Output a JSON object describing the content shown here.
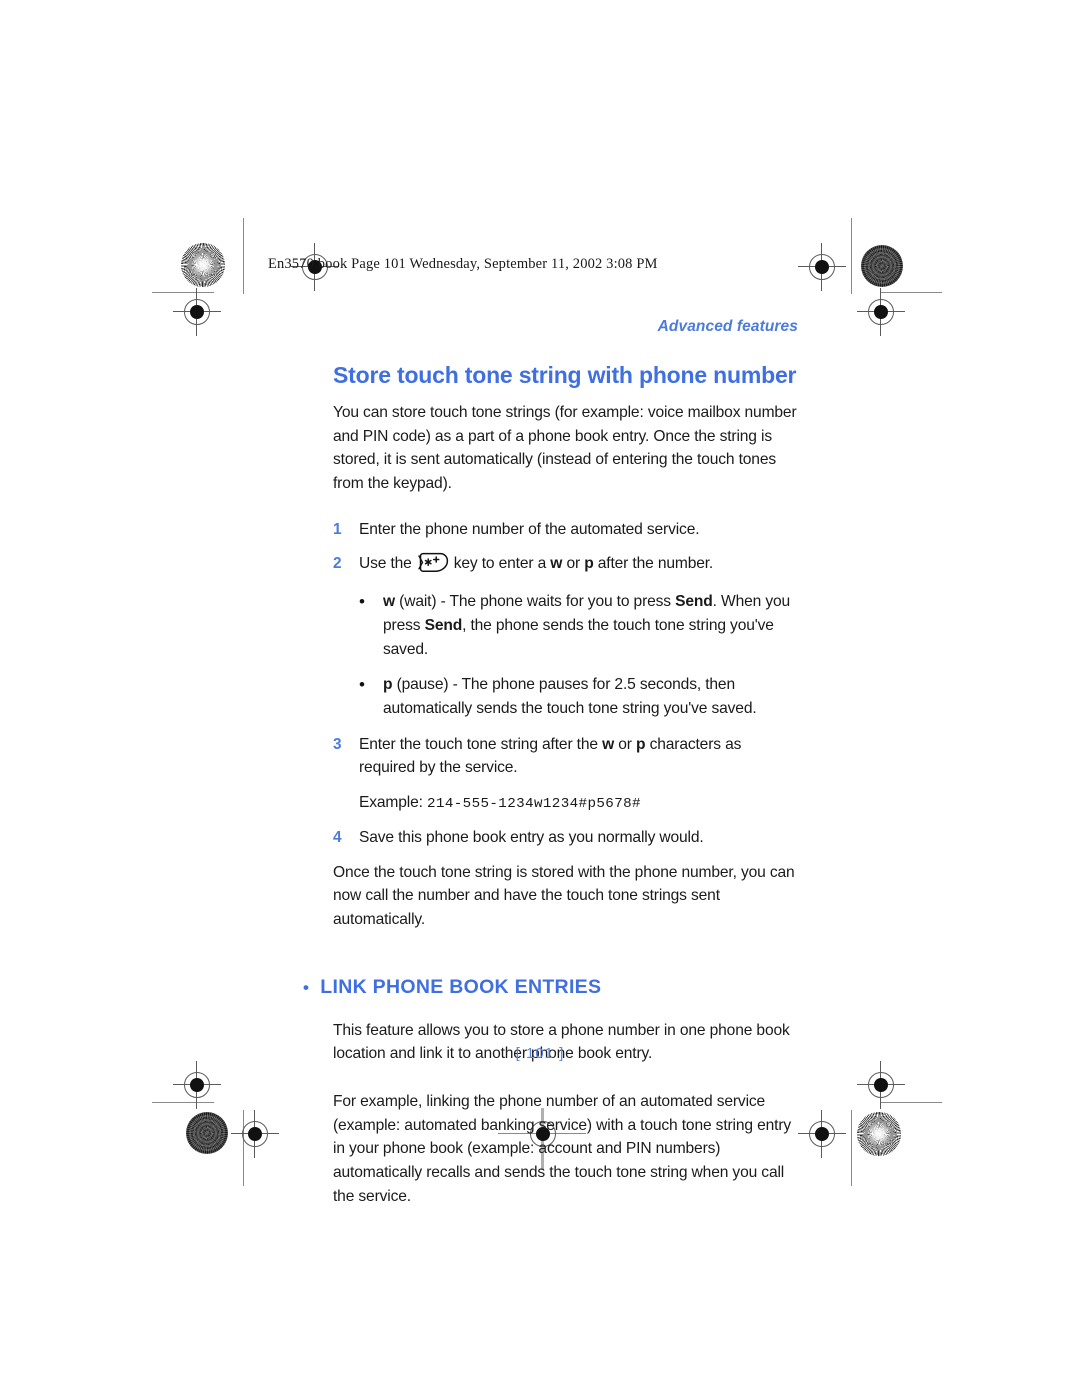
{
  "imprint": {
    "text": "En3570.book  Page 101  Wednesday, September 11, 2002  3:08 PM"
  },
  "running_head": {
    "label": "Advanced features"
  },
  "colors": {
    "accent_blue": "#3f6fe0",
    "runhead_blue": "#4b7bdd",
    "page_number_blue": "#5a84e4",
    "body_text": "#1b1b1b"
  },
  "section1": {
    "title": "Store touch tone string with phone number",
    "intro": "You can store touch tone strings (for example: voice mailbox number and PIN code) as a part of a phone book entry. Once the string is stored, it is sent automatically (instead of entering the touch tones from the keypad).",
    "steps": [
      {
        "num": "1",
        "text_before": "Enter the phone number of the automated service.",
        "has_icon": false
      },
      {
        "num": "2",
        "text_before": "Use the",
        "icon": "star-plus-key-icon",
        "text_after_1": "key to enter a ",
        "bold_1": "w",
        "text_after_2": " or ",
        "bold_2": "p",
        "text_after_3": " after the number.",
        "has_icon": true
      },
      {
        "num": "3",
        "text_before": "Enter the touch tone string after the ",
        "bold_1": "w",
        "text_after_2": " or ",
        "bold_2": "p",
        "text_after_3": " characters as required by the service.",
        "has_icon": false
      },
      {
        "num": "4",
        "text_before": "Save this phone book entry as you normally would.",
        "has_icon": false
      }
    ],
    "sub_bullets": [
      {
        "bullet": "•",
        "bold_1": "w",
        "seg_1": " (wait) - The phone waits for you to press ",
        "bold_2": "Send",
        "seg_2": ". When you press ",
        "bold_3": "Send",
        "seg_3": ", the phone sends the touch tone string you've saved."
      },
      {
        "bullet": "•",
        "bold_1": "p",
        "seg_1": " (pause) - The phone pauses for 2.5 seconds, then automatically sends the touch tone string you've saved.",
        "bold_2": "",
        "seg_2": "",
        "bold_3": "",
        "seg_3": ""
      }
    ],
    "example": {
      "label": "Example:",
      "value": "214-555-1234w1234#p5678#"
    },
    "closing": "Once the touch tone string is stored with the phone number, you can now call the number and have the touch tone strings sent automatically."
  },
  "section2": {
    "bullet": "•",
    "title": "LINK PHONE BOOK ENTRIES",
    "paragraph1": "This feature allows you to store a phone number in one phone book location and link it to another phone book entry.",
    "paragraph2": "For example, linking the phone number of an automated service (example: automated banking service) with a touch tone string entry in your phone book (example: account and PIN numbers) automatically recalls and sends the touch tone string when you call the service."
  },
  "footer": {
    "page_number": "[ 101 ]"
  }
}
